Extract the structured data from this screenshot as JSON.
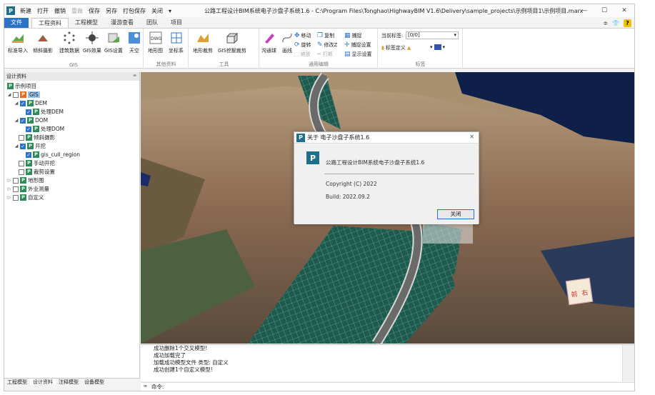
{
  "app": {
    "title": "公路工程设计BIM系统电子沙盘子系统1.6 - C:\\Program Files\\Tonghao\\HighwayBIM V1.6\\Delivery\\sample_projects\\示例项目1\\示例项目.marx",
    "icon": "P"
  },
  "quick_access": [
    "新建",
    "打开",
    "撤销",
    "重做",
    "保存",
    "另存",
    "打包保存",
    "关闭"
  ],
  "ribbon_tabs": [
    "文件",
    "工程资料",
    "工程模型",
    "漫游查看",
    "团队",
    "项目"
  ],
  "ribbon": {
    "gis": {
      "label": "GIS",
      "buttons": [
        "标准导入",
        "倾斜摄影",
        "建筑数据",
        "GIS效果",
        "GIS设置",
        "天空"
      ]
    },
    "other": {
      "label": "其他资料",
      "buttons": [
        "地形图",
        "坐标系"
      ]
    },
    "tools": {
      "label": "工具",
      "buttons": [
        "地形裁剪",
        "GIS挖掘裁剪"
      ]
    },
    "edit": {
      "label": "通用编辑",
      "buttons": [
        "沟通球",
        "画线"
      ],
      "small": [
        "移动",
        "复制",
        "捕捉",
        "旋转",
        "修改Z",
        "捕捉设置",
        "缩放",
        "打断",
        "显示设置"
      ]
    },
    "annot": {
      "label": "标签",
      "current_label": "当前标签:",
      "current_value": "[0/0]",
      "define": "标签定义"
    }
  },
  "panel": {
    "title": "设计资料",
    "pin": "📌"
  },
  "tree": [
    {
      "label": "示例项目",
      "lvl": 0
    },
    {
      "label": "GIS",
      "lvl": 1
    },
    {
      "label": "DEM",
      "lvl": 2
    },
    {
      "label": "处理DEM",
      "lvl": 3
    },
    {
      "label": "DOM",
      "lvl": 2
    },
    {
      "label": "处理DOM",
      "lvl": 3
    },
    {
      "label": "倾斜摄影",
      "lvl": 2
    },
    {
      "label": "开挖",
      "lvl": 2
    },
    {
      "label": "gis_cull_region",
      "lvl": 3
    },
    {
      "label": "手动开挖",
      "lvl": 2
    },
    {
      "label": "裁剪设置",
      "lvl": 2
    },
    {
      "label": "地形图",
      "lvl": 1
    },
    {
      "label": "外业测量",
      "lvl": 1
    },
    {
      "label": "自定义",
      "lvl": 1
    }
  ],
  "bottom_tabs": [
    "工程模型",
    "设计资料",
    "注释模型",
    "设备模型"
  ],
  "output": [
    "成功删除1个交叉模型!",
    "成功加载完了",
    "加载成功模型文件 类型: 自定义",
    "成功创建1个自定义模型!"
  ],
  "cmd": "命令:",
  "dialog": {
    "title": "关于 电子沙盘子系统1.6",
    "product": "公路工程设计BIM系统电子沙盘子系统1.6",
    "copyright": "Copyright (C) 2022",
    "build": "Build: 2022.09.2",
    "ok": "关闭"
  },
  "nav_cube": {
    "face1": "前",
    "face2": "右"
  }
}
